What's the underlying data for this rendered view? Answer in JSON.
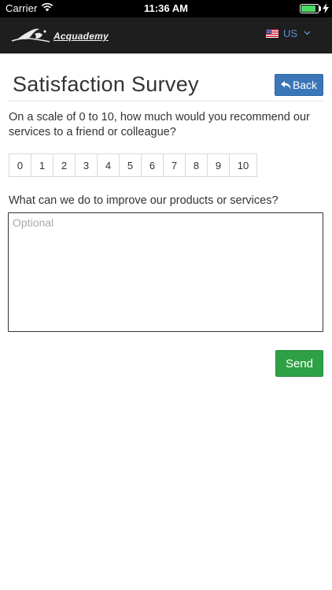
{
  "status_bar": {
    "carrier": "Carrier",
    "time": "11:36 AM",
    "battery_level": 0.85,
    "battery_color": "#4cd964",
    "icons": [
      "wifi-icon",
      "battery-icon",
      "charging-bolt-icon"
    ]
  },
  "nav": {
    "brand": "Acquademy",
    "language": "US",
    "language_color": "#5b8fd6",
    "icons": [
      "acquademy-logo",
      "us-flag-icon",
      "chevron-down-icon"
    ]
  },
  "page": {
    "title": "Satisfaction Survey",
    "back_label": "Back",
    "back_color": "#3b77b8",
    "question_1": "On a scale of 0 to 10, how much would you recommend our services to a friend or colleague?",
    "scale": [
      {
        "label": "0"
      },
      {
        "label": "1"
      },
      {
        "label": "2"
      },
      {
        "label": "3"
      },
      {
        "label": "4"
      },
      {
        "label": "5"
      },
      {
        "label": "6"
      },
      {
        "label": "7"
      },
      {
        "label": "8"
      },
      {
        "label": "9"
      },
      {
        "label": "10"
      }
    ],
    "question_2": "What can we do to improve our products or services?",
    "feedback_placeholder": "Optional",
    "feedback_value": "",
    "send_label": "Send",
    "send_color": "#2ea045"
  }
}
